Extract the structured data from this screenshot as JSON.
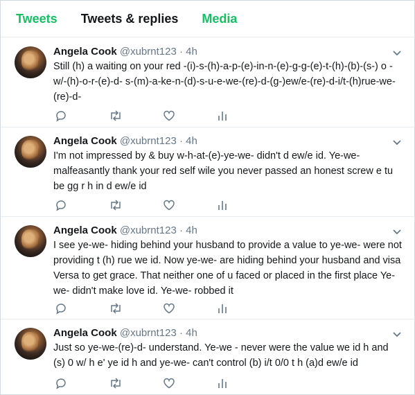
{
  "tabs": [
    {
      "label": "Tweets",
      "color": "#17bf63"
    },
    {
      "label": "Tweets & replies",
      "color": "#14171a"
    },
    {
      "label": "Media",
      "color": "#17bf63"
    }
  ],
  "tweets": [
    {
      "name": "Angela Cook",
      "handle": "@xubrnt123",
      "time": "· 4h",
      "text": "Still (h) a waiting on your red -(i)-s-(h)-a-p-(e)-in-n-(e)-g-g-(e)-t-(h)-(b)-(s-) o - w/-(h)-o-r-(e)-d- s-(m)-a-ke-n-(d)-s-u-e-we-(re)-d-(g-)ew/e-(re)-d-i/t-(h)rue-we-(re)-d-"
    },
    {
      "name": "Angela Cook",
      "handle": "@xubrnt123",
      "time": "· 4h",
      "text": "I'm not impressed by & buy w-h-at-(e)-ye-we- didn't d ew/e id. Ye-we- malfeasantly thank your red self wile you never passed an honest screw e tu be gg r h in d ew/e id"
    },
    {
      "name": "Angela Cook",
      "handle": "@xubrnt123",
      "time": "· 4h",
      "text": "I see ye-we- hiding behind your husband to provide a value to ye-we- were not providing t (h) rue we id. Now ye-we- are hiding behind your husband and visa Versa to get grace. That neither one of u faced or placed in the first place  Ye-we- didn't make love id. Ye-we- robbed it"
    },
    {
      "name": "Angela Cook",
      "handle": "@xubrnt123",
      "time": "· 4h",
      "text": "Just so ye-we-(re)-d- understand. Ye-we -  never were the value we id h and (s) 0 w/ h e' ye id h and ye-we- can't control (b) i/t 0/0 t h (a)d ew/e id"
    }
  ],
  "icons": {
    "reply": "reply-icon",
    "retweet": "retweet-icon",
    "like": "heart-icon",
    "analytics": "analytics-icon",
    "caret": "chevron-down-icon"
  },
  "colors": {
    "icon": "#657786",
    "accent": "#17bf63"
  }
}
